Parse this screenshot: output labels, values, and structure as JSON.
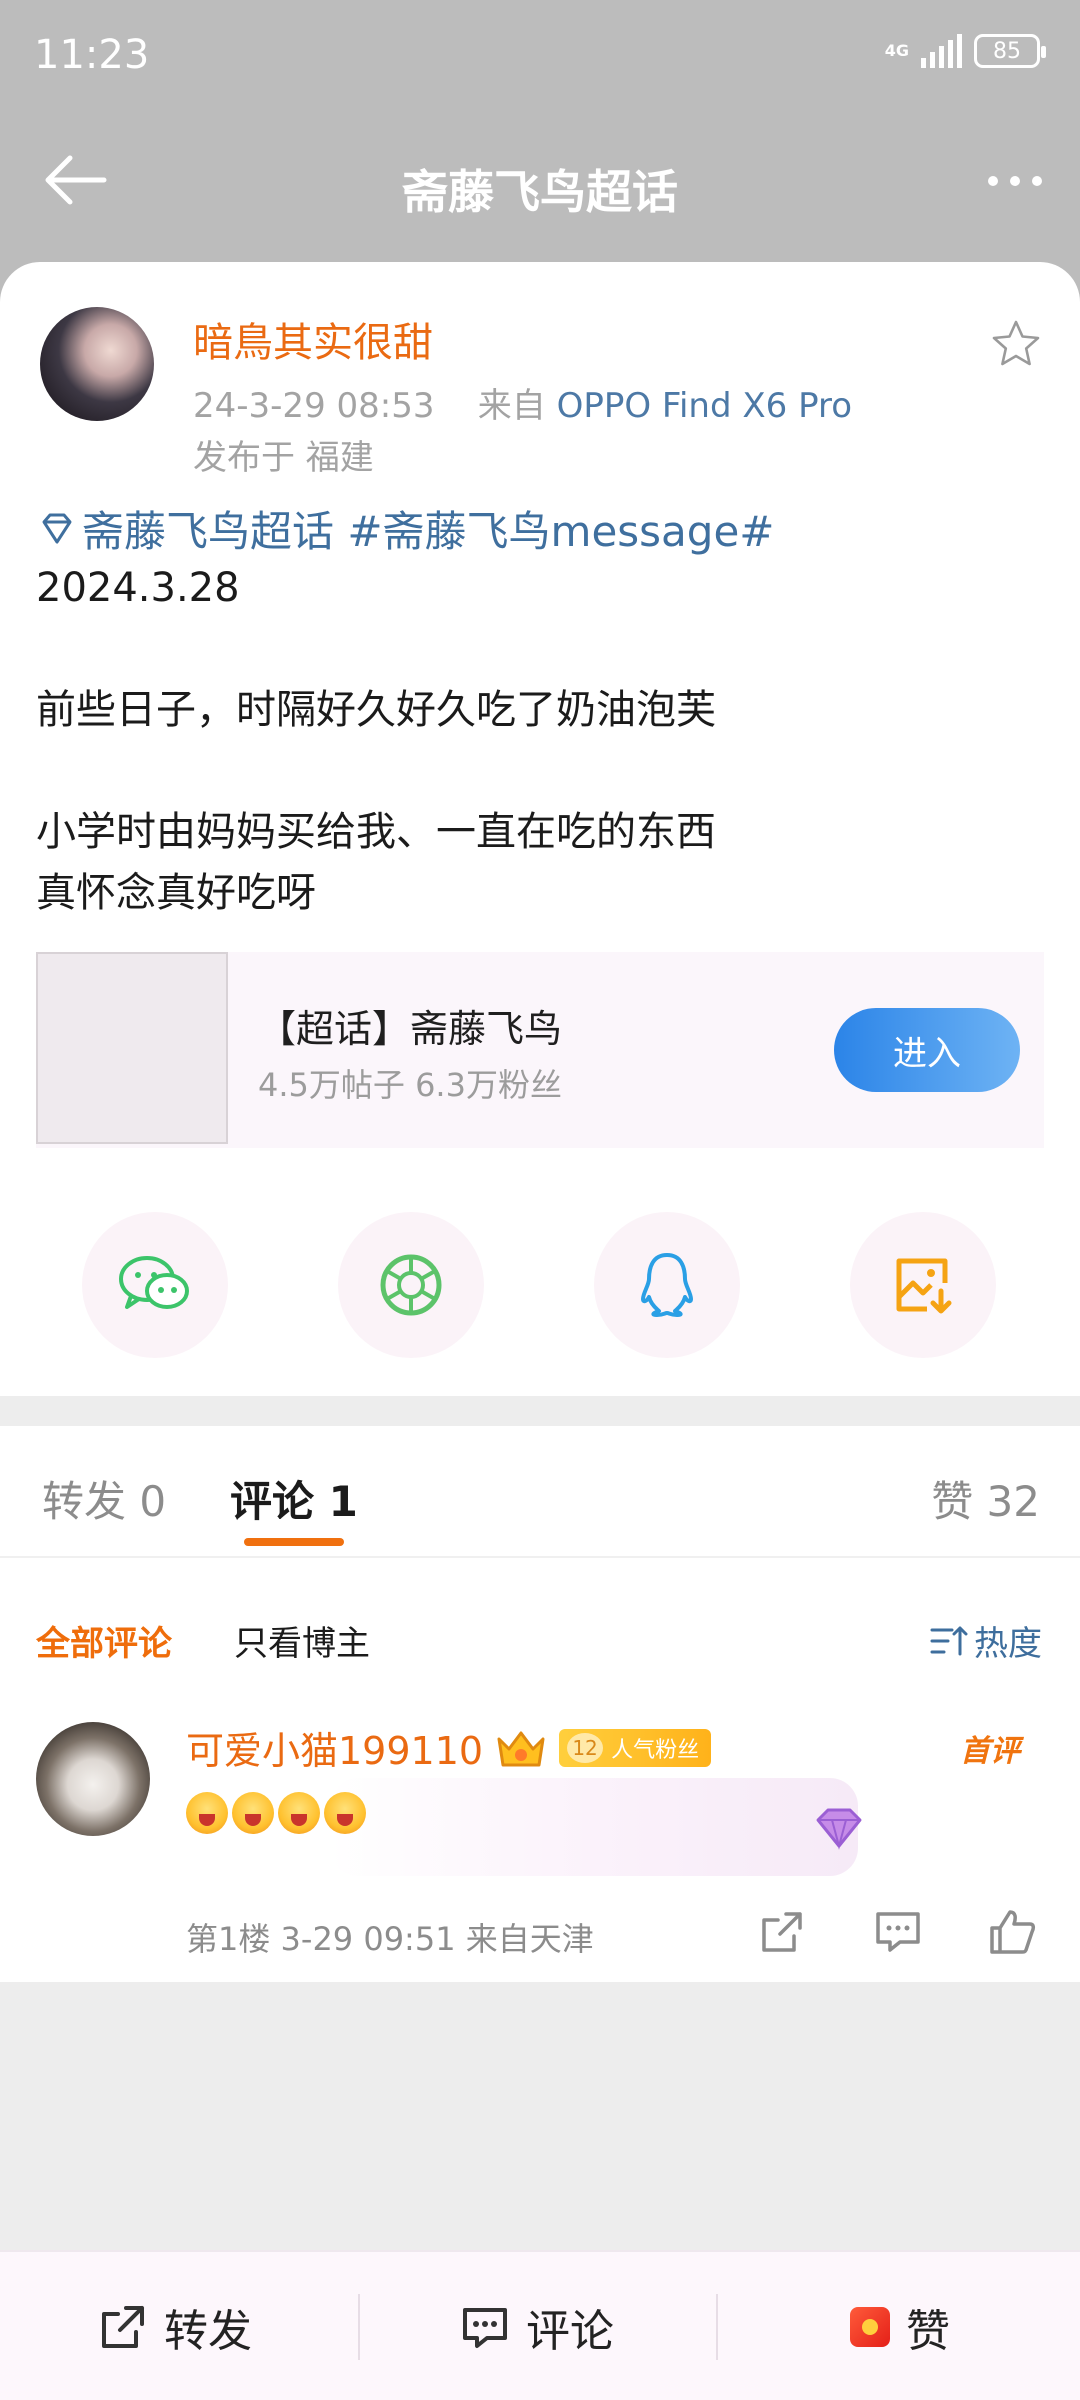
{
  "status_bar": {
    "time": "11:23",
    "network": "4G",
    "battery": "85"
  },
  "header": {
    "title": "斋藤飞鸟超话"
  },
  "post": {
    "username": "暗鳥其实很甜",
    "date": "24-3-29 08:53",
    "source_prefix": "来自",
    "device": "OPPO Find X6 Pro",
    "location": "发布于 福建",
    "tags": "斋藤飞鸟超话 #斋藤飞鸟message#",
    "body": "2024.3.28\n\n前些日子，时隔好久好久吃了奶油泡芙\n\n小学时由妈妈买给我、一直在吃的东西\n真怀念真好吃呀"
  },
  "topic_card": {
    "title": "【超话】斋藤飞鸟",
    "stats": "4.5万帖子 6.3万粉丝",
    "button": "进入"
  },
  "share": {
    "icons": [
      "wechat-icon",
      "moments-icon",
      "qq-icon",
      "save-image-icon"
    ]
  },
  "tabs": {
    "repost": "转发 0",
    "comments": "评论 1",
    "likes": "赞 32"
  },
  "comment_filters": {
    "all": "全部评论",
    "owner_only": "只看博主",
    "sort": "热度"
  },
  "comment": {
    "username": "可爱小猫199110",
    "fan_level": "12",
    "fan_badge": "人气粉丝",
    "first_label": "首评",
    "meta": "第1楼 3-29 09:51 来自天津"
  },
  "bottom_bar": {
    "repost": "转发",
    "comment": "评论",
    "like": "赞"
  },
  "colors": {
    "accent_orange": "#ea6a12",
    "link_blue": "#3f6f9e",
    "header_grey": "#bcbcbc"
  }
}
